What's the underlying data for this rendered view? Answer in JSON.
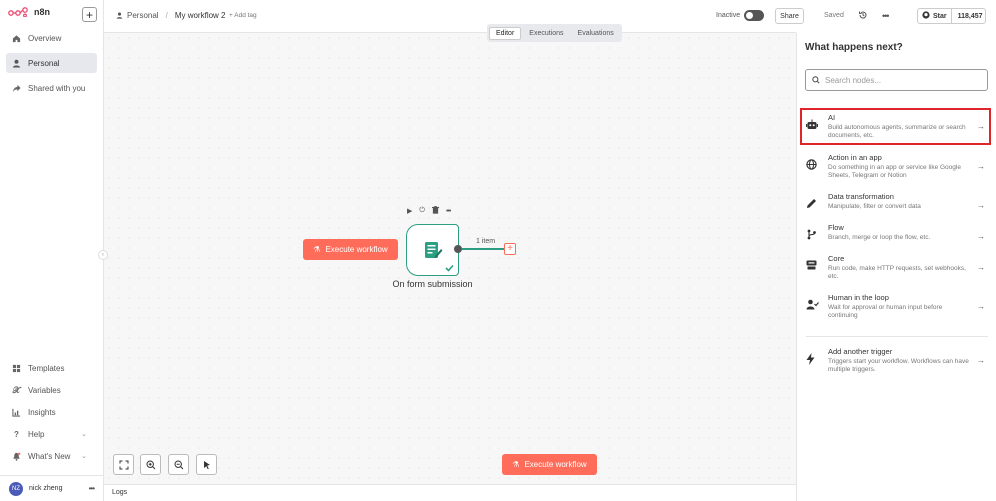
{
  "app": {
    "name": "n8n",
    "logo_icon": "n8n-logo-icon"
  },
  "sidebar": {
    "items": [
      {
        "label": "Overview",
        "icon": "home-icon"
      },
      {
        "label": "Personal",
        "icon": "user-icon",
        "active": true
      },
      {
        "label": "Shared with you",
        "icon": "share-icon"
      }
    ],
    "bottom_items": [
      {
        "label": "Templates",
        "icon": "templates-icon"
      },
      {
        "label": "Variables",
        "icon": "variables-icon"
      },
      {
        "label": "Insights",
        "icon": "insights-icon"
      },
      {
        "label": "Help",
        "icon": "help-icon"
      },
      {
        "label": "What's New",
        "icon": "bell-icon"
      }
    ],
    "user": {
      "initials": "NZ",
      "name": "nick zheng"
    }
  },
  "header": {
    "breadcrumb_project": "Personal",
    "breadcrumb_separator": "/",
    "workflow_name": "My workflow 2",
    "add_tag": "+ Add tag",
    "status": "Inactive",
    "share": "Share",
    "saved": "Saved",
    "star_label": "Star",
    "star_count": "118,457"
  },
  "tabs": [
    {
      "label": "Editor",
      "active": true
    },
    {
      "label": "Executions"
    },
    {
      "label": "Evaluations"
    }
  ],
  "canvas": {
    "execute_button": "Execute workflow",
    "node_label": "On form submission",
    "edge_label": "1 item",
    "bottom_execute_button": "Execute workflow"
  },
  "logs": {
    "label": "Logs"
  },
  "panel": {
    "title": "What happens next?",
    "search_placeholder": "Search nodes...",
    "items": [
      {
        "title": "AI",
        "desc": "Build autonomous agents, summarize or search documents, etc.",
        "icon": "robot-icon"
      },
      {
        "title": "Action in an app",
        "desc": "Do something in an app or service like Google Sheets, Telegram or Notion",
        "icon": "globe-icon"
      },
      {
        "title": "Data transformation",
        "desc": "Manipulate, filter or convert data",
        "icon": "pen-icon"
      },
      {
        "title": "Flow",
        "desc": "Branch, merge or loop the flow, etc.",
        "icon": "branch-icon"
      },
      {
        "title": "Core",
        "desc": "Run code, make HTTP requests, set webhooks, etc.",
        "icon": "core-icon"
      },
      {
        "title": "Human in the loop",
        "desc": "Wait for approval or human input before continuing",
        "icon": "human-check-icon"
      }
    ],
    "trigger": {
      "title": "Add another trigger",
      "desc": "Triggers start your workflow. Workflows can have multiple triggers.",
      "icon": "bolt-icon"
    }
  },
  "colors": {
    "accent": "#ff6d5a",
    "node_border": "#2b9e84",
    "highlight": "#e0242b"
  }
}
